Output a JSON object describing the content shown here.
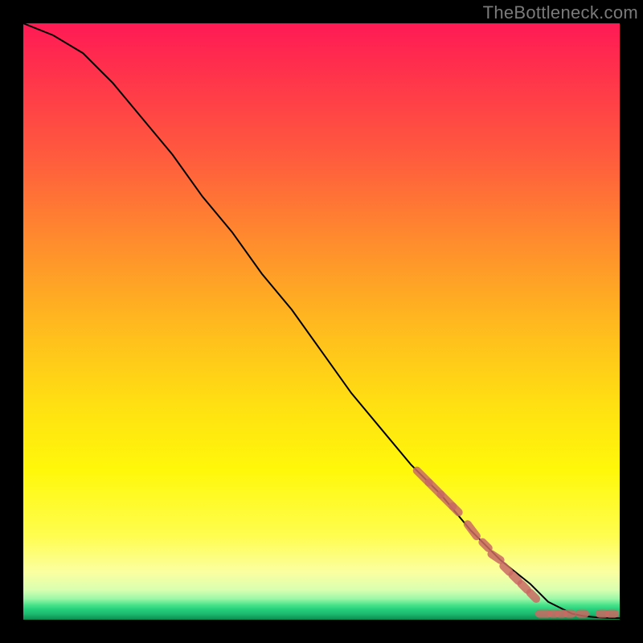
{
  "watermark": "TheBottleneck.com",
  "colors": {
    "page_bg": "#000000",
    "curve": "#000000",
    "dash": "#c96a63"
  },
  "chart_data": {
    "type": "line",
    "title": "",
    "xlabel": "",
    "ylabel": "",
    "xlim": [
      0,
      100
    ],
    "ylim": [
      0,
      100
    ],
    "grid": false,
    "legend": false,
    "series": [
      {
        "name": "curve",
        "x": [
          0,
          5,
          10,
          15,
          20,
          25,
          30,
          35,
          40,
          45,
          50,
          55,
          60,
          65,
          70,
          75,
          80,
          85,
          88,
          90,
          92,
          94,
          96,
          98,
          100
        ],
        "y": [
          100,
          98,
          95,
          90,
          84,
          78,
          71,
          65,
          58,
          52,
          45,
          38,
          32,
          26,
          21,
          15,
          10,
          6,
          3,
          2,
          1,
          0.6,
          0.4,
          0.3,
          0.25
        ]
      }
    ],
    "dashes_on_curve": [
      {
        "x0": 66,
        "y0": 25,
        "x1": 68,
        "y1": 23
      },
      {
        "x0": 68,
        "y0": 23,
        "x1": 70,
        "y1": 21
      },
      {
        "x0": 70,
        "y0": 21,
        "x1": 72,
        "y1": 19
      },
      {
        "x0": 72,
        "y0": 19,
        "x1": 73,
        "y1": 18
      },
      {
        "x0": 74.5,
        "y0": 16,
        "x1": 76,
        "y1": 14
      },
      {
        "x0": 77,
        "y0": 13,
        "x1": 78,
        "y1": 12
      },
      {
        "x0": 78.5,
        "y0": 11,
        "x1": 80,
        "y1": 10
      },
      {
        "x0": 80.5,
        "y0": 9,
        "x1": 81.5,
        "y1": 8
      },
      {
        "x0": 82,
        "y0": 7.5,
        "x1": 83,
        "y1": 6.5
      },
      {
        "x0": 83.5,
        "y0": 6,
        "x1": 84.5,
        "y1": 5
      },
      {
        "x0": 85,
        "y0": 4.5,
        "x1": 86,
        "y1": 3.5
      }
    ],
    "dashes_flat": [
      {
        "x0": 86.5,
        "y0": 1.0,
        "x1": 88.0,
        "y1": 1.0
      },
      {
        "x0": 88.5,
        "y0": 1.0,
        "x1": 89.3,
        "y1": 1.0
      },
      {
        "x0": 89.8,
        "y0": 1.0,
        "x1": 90.6,
        "y1": 1.0
      },
      {
        "x0": 91.2,
        "y0": 1.0,
        "x1": 92.0,
        "y1": 1.0
      },
      {
        "x0": 93.2,
        "y0": 1.0,
        "x1": 94.2,
        "y1": 1.0
      },
      {
        "x0": 96.6,
        "y0": 1.0,
        "x1": 97.6,
        "y1": 1.0
      },
      {
        "x0": 98.2,
        "y0": 1.0,
        "x1": 99.2,
        "y1": 1.0
      }
    ]
  }
}
